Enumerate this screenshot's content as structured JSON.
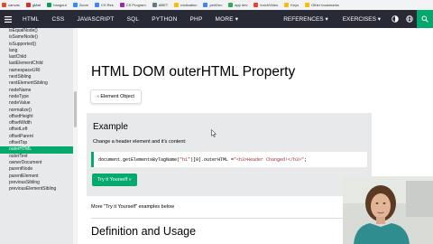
{
  "bookmarks": [
    {
      "label": "canvas",
      "color": "#e34c26"
    },
    {
      "label": "gMail",
      "color": "#d93025"
    },
    {
      "label": "hangout",
      "color": "#0f9d58"
    },
    {
      "label": "Zoom",
      "color": "#2d8cff"
    },
    {
      "label": "CS Res",
      "color": "#4285f4"
    },
    {
      "label": "CS Program",
      "color": "#9c27b0"
    },
    {
      "label": "ABET",
      "color": "#607d8b"
    },
    {
      "label": "motivation",
      "color": "#fbbc05"
    },
    {
      "label": "penDec",
      "color": "#4285f4"
    },
    {
      "label": "app dev",
      "color": "#34a853"
    },
    {
      "label": "lunchVideo",
      "color": "#ea4335"
    },
    {
      "label": "Keys",
      "color": "#fbbc05"
    },
    {
      "label": "Other bookmarks",
      "color": "#fbbc05"
    }
  ],
  "nav": {
    "items": [
      "HTML",
      "CSS",
      "JAVASCRIPT",
      "SQL",
      "PYTHON",
      "PHP",
      "MORE ▾"
    ],
    "right": [
      "REFERENCES ▾",
      "EXERCISES ▾"
    ],
    "colors": {
      "bar": "#282a35",
      "accent": "#04aa6d"
    }
  },
  "sidebar": {
    "items": [
      "isEqualNode()",
      "isSameNode()",
      "isSupported()",
      "lang",
      "lastChild",
      "lastElementChild",
      "namespaceURI",
      "nextSibling",
      "nextElementSibling",
      "nodeName",
      "nodeType",
      "nodeValue",
      "normalize()",
      "offsetHeight",
      "offsetWidth",
      "offsetLeft",
      "offsetParent",
      "offsetTop",
      "outerHTML",
      "outerText",
      "ownerDocument",
      "parentNode",
      "parentElement",
      "previousSibling",
      "previousElementSibling"
    ],
    "active": "outerHTML"
  },
  "main": {
    "title": "HTML DOM outerHTML Property",
    "prev_button": "‹ Element Object",
    "example": {
      "heading": "Example",
      "description": "Change a header element and it's content:",
      "code": {
        "part1": "document.getElementsByTagName(",
        "str1": "\"h1\"",
        "part2": ")[0].outerHTML = ",
        "str2": "\"<h3>Header Changed!</h3>\"",
        "part3": ";"
      },
      "try_button": "Try it Yourself »"
    },
    "more_text": "More \"Try it Yourself\" examples below",
    "section_heading": "Definition and Usage"
  }
}
